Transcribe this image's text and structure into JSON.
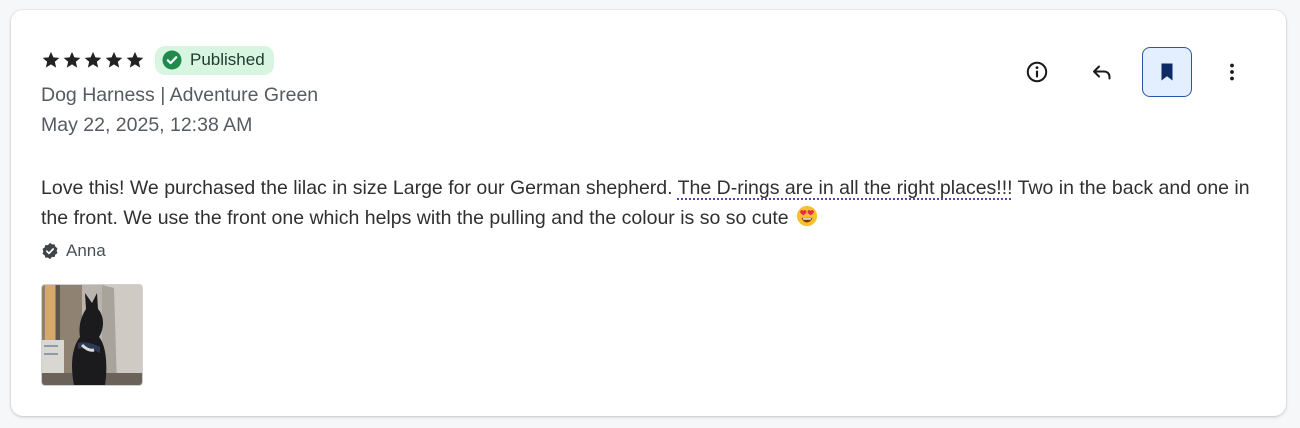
{
  "review": {
    "rating": 5,
    "max_rating": 5,
    "status": "Published",
    "product": "Dog Harness | Adventure Green",
    "date": "May 22, 2025, 12:38 AM",
    "body_before": "Love this! We purchased the lilac in size Large for our German shepherd. ",
    "body_highlight": "The D-rings are in all the right places!!!",
    "body_after": " Two in the back and one in the front. We use the front one which helps with the pulling and the colour is so so cute",
    "emoji_icon": "smiling-face-with-heart-eyes-icon",
    "author": "Anna",
    "author_verified": true,
    "photos": [
      {
        "icon": "dog-photo"
      }
    ]
  },
  "actions": {
    "info_icon": "info-icon",
    "reply_icon": "reply-icon",
    "bookmark_icon": "bookmark-icon",
    "bookmark_active": true,
    "more_icon": "more-vertical-icon"
  },
  "colors": {
    "badge_bg": "#d8f5e1",
    "badge_icon": "#1f8a4c",
    "bookmark_bg": "#e3efff",
    "bookmark_border": "#2b56a8",
    "bookmark_icon": "#0b2a66",
    "highlight_underline": "#5b3fb8"
  }
}
